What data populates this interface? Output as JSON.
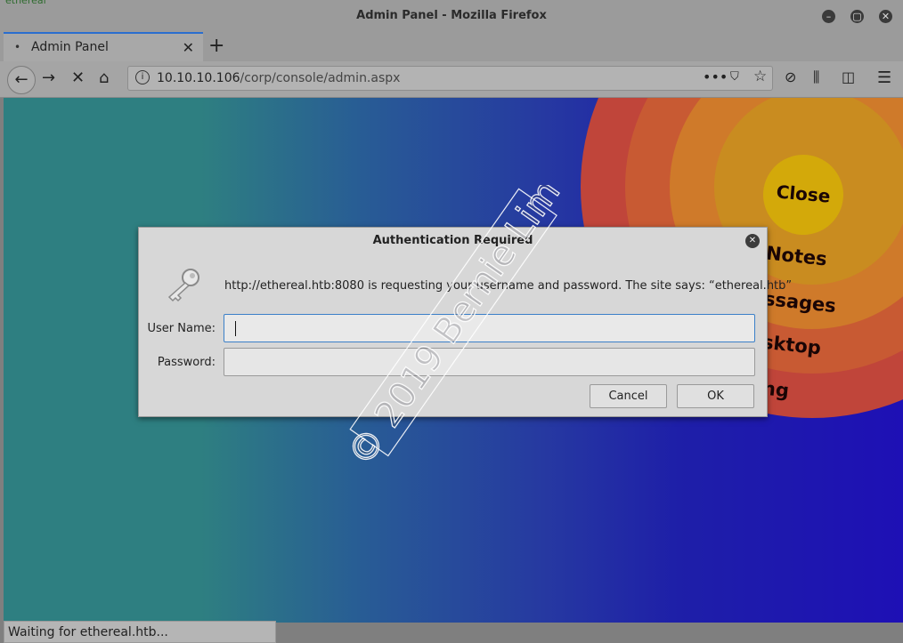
{
  "window": {
    "desktop_label": "ethereal",
    "title": "Admin Panel - Mozilla Firefox"
  },
  "tabs": [
    {
      "label": "Admin Panel"
    }
  ],
  "navbar": {
    "url_host": "10.10.10.106",
    "url_path": "/corp/console/admin.aspx"
  },
  "page_menu": {
    "close_label": "Close",
    "items": [
      "Notes",
      "ssages",
      "sktop",
      "ng"
    ]
  },
  "dialog": {
    "title": "Authentication Required",
    "message": "http://ethereal.htb:8080 is requesting your username and password. The site says: “ethereal.htb”",
    "username_label": "User Name:",
    "username_value": "",
    "password_label": "Password:",
    "password_value": "",
    "cancel_label": "Cancel",
    "ok_label": "OK"
  },
  "watermark": "© 2019 Bernie Lim",
  "status_bar": "Waiting for ethereal.htb...",
  "colors": {
    "accent": "#2a6ecf",
    "ring_outer": "#c0453a",
    "ring_2": "#c85a33",
    "ring_3": "#cf7a2a",
    "ring_4": "#c98c20",
    "close_button": "#d3a90a"
  }
}
